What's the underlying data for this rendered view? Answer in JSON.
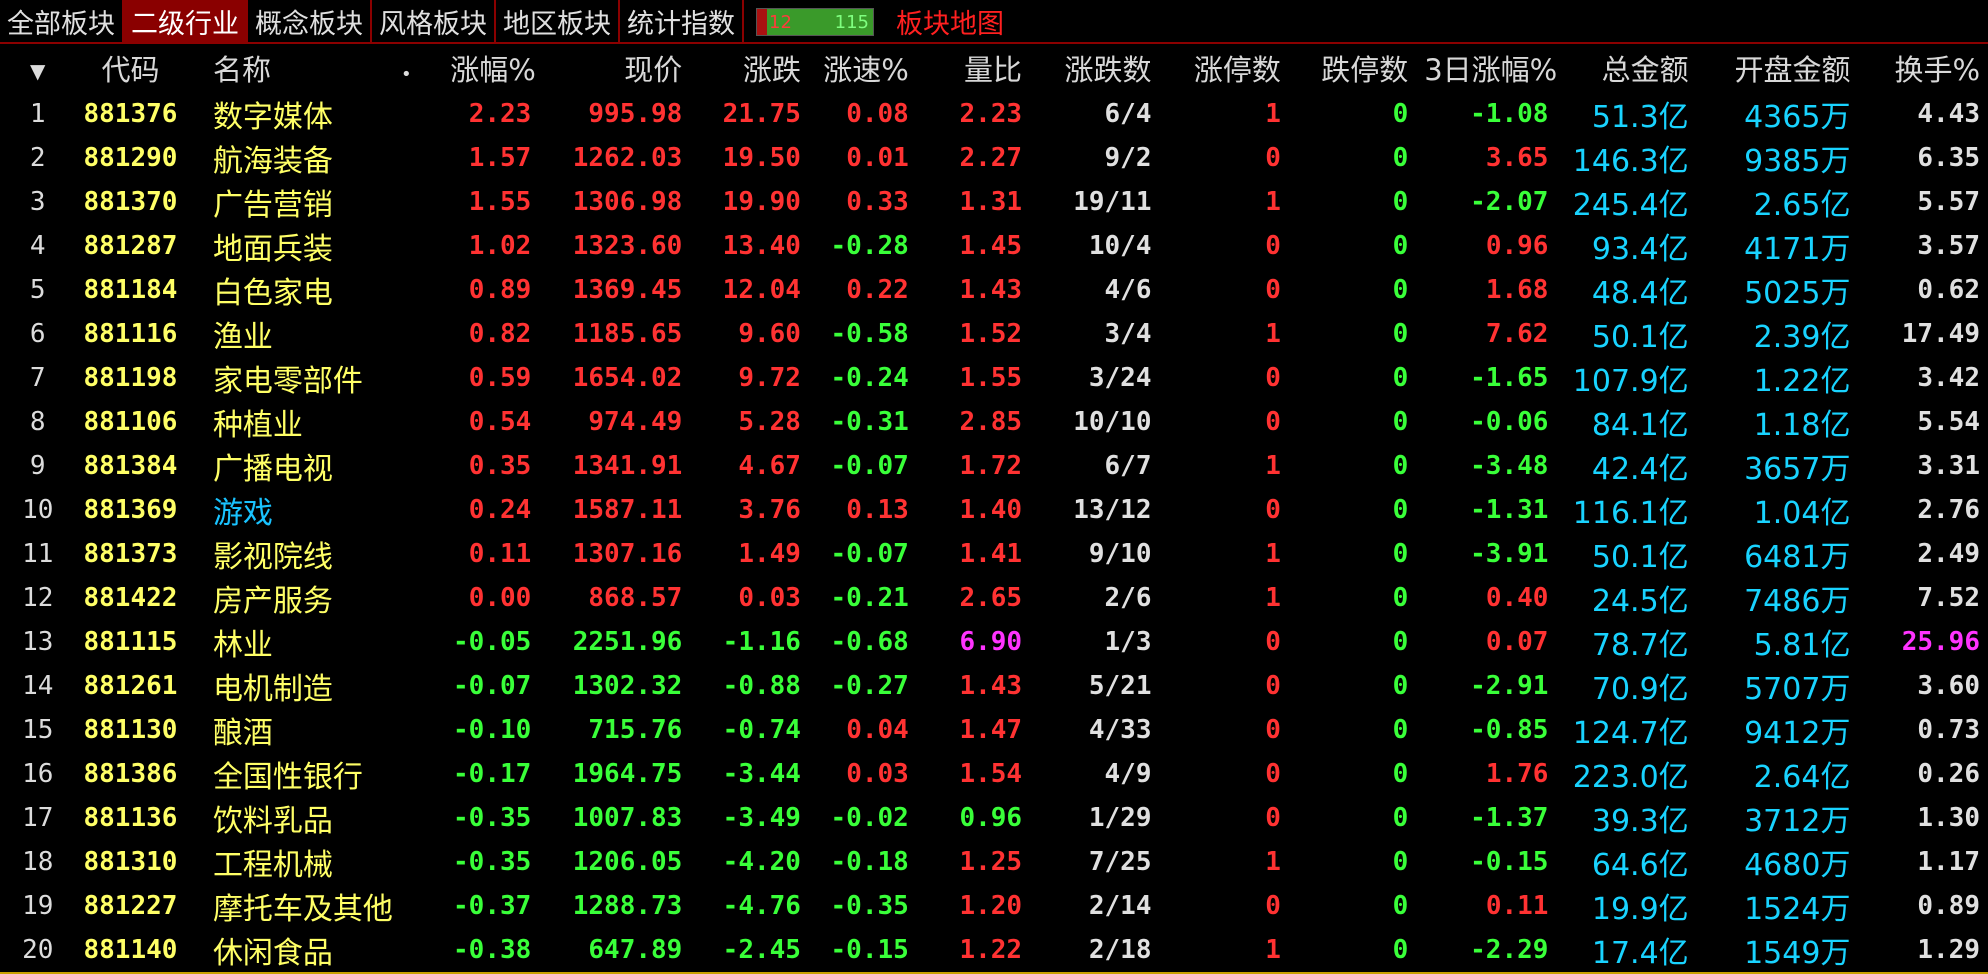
{
  "tabs": [
    "全部板块",
    "二级行业",
    "概念板块",
    "风格板块",
    "地区板块",
    "统计指数"
  ],
  "active_tab": 1,
  "counter": {
    "up": "12",
    "down": "115"
  },
  "map_label": "板块地图",
  "headers": {
    "sort": "▼",
    "code": "代码",
    "name": "名称",
    "dot": "•",
    "change_pct": "涨幅%",
    "sort_arrow": "↓",
    "price": "现价",
    "change": "涨跌",
    "speed": "涨速%",
    "volume_ratio": "量比",
    "updown_count": "涨跌数",
    "limit_up": "涨停数",
    "limit_down": "跌停数",
    "three_day": "3日涨幅%",
    "amount": "总金额",
    "open_amount": "开盘金额",
    "turnover": "换手%"
  },
  "rows": [
    [
      "1",
      "881376",
      "数字媒体",
      "2.23",
      "995.98",
      "21.75",
      "0.08",
      "2.23",
      "6/4",
      "1",
      "0",
      "-1.08",
      "51.3亿",
      "4365万",
      "4.43"
    ],
    [
      "2",
      "881290",
      "航海装备",
      "1.57",
      "1262.03",
      "19.50",
      "0.01",
      "2.27",
      "9/2",
      "0",
      "0",
      "3.65",
      "146.3亿",
      "9385万",
      "6.35"
    ],
    [
      "3",
      "881370",
      "广告营销",
      "1.55",
      "1306.98",
      "19.90",
      "0.33",
      "1.31",
      "19/11",
      "1",
      "0",
      "-2.07",
      "245.4亿",
      "2.65亿",
      "5.57"
    ],
    [
      "4",
      "881287",
      "地面兵装",
      "1.02",
      "1323.60",
      "13.40",
      "-0.28",
      "1.45",
      "10/4",
      "0",
      "0",
      "0.96",
      "93.4亿",
      "4171万",
      "3.57"
    ],
    [
      "5",
      "881184",
      "白色家电",
      "0.89",
      "1369.45",
      "12.04",
      "0.22",
      "1.43",
      "4/6",
      "0",
      "0",
      "1.68",
      "48.4亿",
      "5025万",
      "0.62"
    ],
    [
      "6",
      "881116",
      "渔业",
      "0.82",
      "1185.65",
      "9.60",
      "-0.58",
      "1.52",
      "3/4",
      "1",
      "0",
      "7.62",
      "50.1亿",
      "2.39亿",
      "17.49"
    ],
    [
      "7",
      "881198",
      "家电零部件",
      "0.59",
      "1654.02",
      "9.72",
      "-0.24",
      "1.55",
      "3/24",
      "0",
      "0",
      "-1.65",
      "107.9亿",
      "1.22亿",
      "3.42"
    ],
    [
      "8",
      "881106",
      "种植业",
      "0.54",
      "974.49",
      "5.28",
      "-0.31",
      "2.85",
      "10/10",
      "0",
      "0",
      "-0.06",
      "84.1亿",
      "1.18亿",
      "5.54"
    ],
    [
      "9",
      "881384",
      "广播电视",
      "0.35",
      "1341.91",
      "4.67",
      "-0.07",
      "1.72",
      "6/7",
      "1",
      "0",
      "-3.48",
      "42.4亿",
      "3657万",
      "3.31"
    ],
    [
      "10",
      "881369",
      "游戏",
      "0.24",
      "1587.11",
      "3.76",
      "0.13",
      "1.40",
      "13/12",
      "0",
      "0",
      "-1.31",
      "116.1亿",
      "1.04亿",
      "2.76"
    ],
    [
      "11",
      "881373",
      "影视院线",
      "0.11",
      "1307.16",
      "1.49",
      "-0.07",
      "1.41",
      "9/10",
      "1",
      "0",
      "-3.91",
      "50.1亿",
      "6481万",
      "2.49"
    ],
    [
      "12",
      "881422",
      "房产服务",
      "0.00",
      "868.57",
      "0.03",
      "-0.21",
      "2.65",
      "2/6",
      "1",
      "0",
      "0.40",
      "24.5亿",
      "7486万",
      "7.52"
    ],
    [
      "13",
      "881115",
      "林业",
      "-0.05",
      "2251.96",
      "-1.16",
      "-0.68",
      "6.90",
      "1/3",
      "0",
      "0",
      "0.07",
      "78.7亿",
      "5.81亿",
      "25.96"
    ],
    [
      "14",
      "881261",
      "电机制造",
      "-0.07",
      "1302.32",
      "-0.88",
      "-0.27",
      "1.43",
      "5/21",
      "0",
      "0",
      "-2.91",
      "70.9亿",
      "5707万",
      "3.60"
    ],
    [
      "15",
      "881130",
      "酿酒",
      "-0.10",
      "715.76",
      "-0.74",
      "0.04",
      "1.47",
      "4/33",
      "0",
      "0",
      "-0.85",
      "124.7亿",
      "9412万",
      "0.73"
    ],
    [
      "16",
      "881386",
      "全国性银行",
      "-0.17",
      "1964.75",
      "-3.44",
      "0.03",
      "1.54",
      "4/9",
      "0",
      "0",
      "1.76",
      "223.0亿",
      "2.64亿",
      "0.26"
    ],
    [
      "17",
      "881136",
      "饮料乳品",
      "-0.35",
      "1007.83",
      "-3.49",
      "-0.02",
      "0.96",
      "1/29",
      "0",
      "0",
      "-1.37",
      "39.3亿",
      "3712万",
      "1.30"
    ],
    [
      "18",
      "881310",
      "工程机械",
      "-0.35",
      "1206.05",
      "-4.20",
      "-0.18",
      "1.25",
      "7/25",
      "1",
      "0",
      "-0.15",
      "64.6亿",
      "4680万",
      "1.17"
    ],
    [
      "19",
      "881227",
      "摩托车及其他",
      "-0.37",
      "1288.73",
      "-4.76",
      "-0.35",
      "1.20",
      "2/14",
      "0",
      "0",
      "0.11",
      "19.9亿",
      "1524万",
      "0.89"
    ],
    [
      "20",
      "881140",
      "休闲食品",
      "-0.38",
      "647.89",
      "-2.45",
      "-0.15",
      "1.22",
      "2/18",
      "1",
      "0",
      "-2.29",
      "17.4亿",
      "1549万",
      "1.29"
    ]
  ],
  "colors": {
    "up": "#ff3232",
    "down": "#39ff39",
    "cyan": "#19d3ff",
    "magenta": "#ff33ff",
    "code": "#ffff66"
  }
}
